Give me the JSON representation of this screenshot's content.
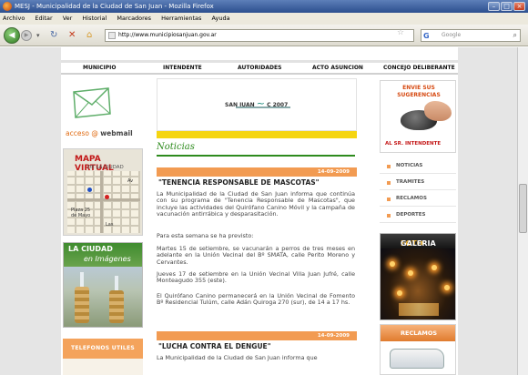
{
  "window": {
    "title": "MESJ - Municipalidad de la Ciudad de San Juan - Mozilla Firefox"
  },
  "menu": [
    "Archivo",
    "Editar",
    "Ver",
    "Historial",
    "Marcadores",
    "Herramientas",
    "Ayuda"
  ],
  "toolbar": {
    "url": "http://www.municipiosanjuan.gov.ar",
    "search_placeholder": "Google"
  },
  "site_nav": [
    "MUNICIPIO",
    "INTENDENTE",
    "AUTORIDADES",
    "ACTO ASUNCION",
    "CONCEJO DELIBERANTE"
  ],
  "left": {
    "webmail_prefix": "acceso",
    "webmail_label": "webmail",
    "map_title": "MAPA VIRTUAL",
    "map_subtitle": "DE LA CIUDAD",
    "map_labels": [
      "Plaza 25 de Mayo",
      "Av",
      "Las"
    ],
    "ciudad_title": "LA CIUDAD",
    "ciudad_subtitle": "en Imágenes",
    "telefonos": "TELEFONOS UTILES"
  },
  "banner": {
    "logo_text": "SAN JUAN",
    "logo_suffix": "C 2007"
  },
  "news": {
    "section_title": "Noticias",
    "items": [
      {
        "date": "14-09-2009",
        "title": "\"TENENCIA RESPONSABLE DE MASCOTAS\"",
        "paragraphs": [
          "La Municipalidad de la Ciudad de San Juan informa que continúa con su programa de \"Tenencia Responsable de Mascotas\", que incluye las actividades del Quirófano Canino Móvil y la campaña de vacunación antirrábica y desparasitación.",
          "Para esta semana se ha previsto:",
          "Martes 15 de setiembre, se vacunarán a perros de tres meses en adelante en la Unión Vecinal del Bº SMATA, calle Perito Moreno y Cervantes.",
          "Jueves 17 de setiembre en la Unión Vecinal Villa Juan Jufré, calle Monteagudo 355 (este).",
          "El Quirófano Canino permanecerá en la Unión Vecinal de Fomento Bº Residencial Tulúm, calle Adán Quiroga 270 (sur), de 14 a 17 hs."
        ]
      },
      {
        "date": "14-09-2009",
        "title": "\"LUCHA CONTRA EL DENGUE\"",
        "paragraphs": [
          "La Municipalidad de la Ciudad de San Juan informa que"
        ]
      }
    ]
  },
  "right": {
    "suggest_line1": "ENVIE SUS",
    "suggest_line2": "SUGERENCIAS",
    "suggest_footer": "AL SR. INTENDENTE",
    "links": [
      "NOTICIAS",
      "TRAMITES",
      "RECLAMOS",
      "DEPORTES"
    ],
    "foto_a": "FOTO",
    "foto_b": "GALERIA",
    "reclamos": "RECLAMOS"
  },
  "colors": {
    "accent_orange": "#f29b52",
    "accent_green": "#2e8b1e",
    "title_red": "#d64a12"
  }
}
